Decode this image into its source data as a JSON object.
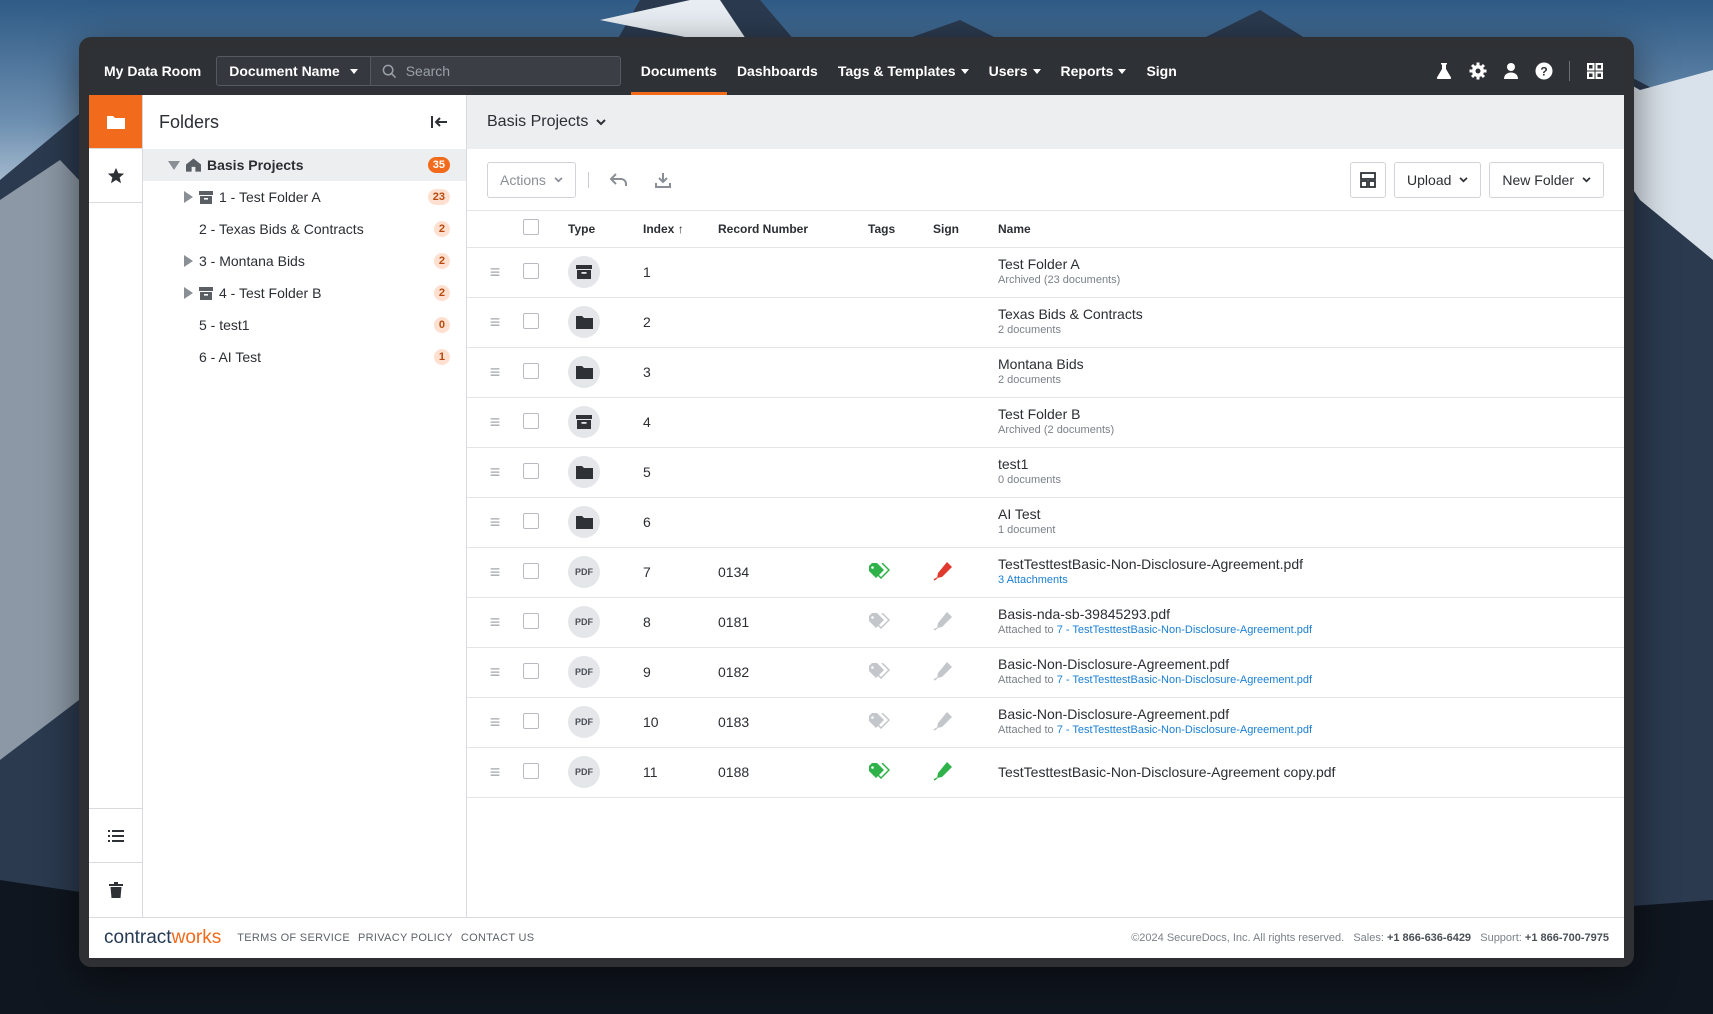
{
  "topnav": {
    "brand": "My Data Room",
    "doc_select": "Document Name",
    "search_placeholder": "Search",
    "links": [
      {
        "label": "Documents",
        "active": true,
        "dropdown": false
      },
      {
        "label": "Dashboards",
        "active": false,
        "dropdown": false
      },
      {
        "label": "Tags & Templates",
        "active": false,
        "dropdown": true
      },
      {
        "label": "Users",
        "active": false,
        "dropdown": true
      },
      {
        "label": "Reports",
        "active": false,
        "dropdown": true
      },
      {
        "label": "Sign",
        "active": false,
        "dropdown": false
      }
    ],
    "icons": [
      "flask-icon",
      "gear-icon",
      "user-icon",
      "help-icon",
      "apps-grid-icon"
    ]
  },
  "folders": {
    "title": "Folders",
    "root": {
      "label": "Basis Projects",
      "count": "35"
    },
    "items": [
      {
        "label": "1 - Test Folder A",
        "count": "23",
        "expandable": true,
        "archived": true
      },
      {
        "label": "2 - Texas Bids & Contracts",
        "count": "2",
        "expandable": false,
        "archived": false
      },
      {
        "label": "3 - Montana Bids",
        "count": "2",
        "expandable": true,
        "archived": false
      },
      {
        "label": "4 - Test Folder B",
        "count": "2",
        "expandable": true,
        "archived": true
      },
      {
        "label": "5 - test1",
        "count": "0",
        "expandable": false,
        "archived": false
      },
      {
        "label": "6 - AI Test",
        "count": "1",
        "expandable": false,
        "archived": false
      }
    ]
  },
  "content": {
    "breadcrumb": "Basis Projects",
    "toolbar": {
      "actions": "Actions",
      "upload": "Upload",
      "new_folder": "New Folder"
    },
    "columns": {
      "type": "Type",
      "index": "Index",
      "record": "Record Number",
      "tags": "Tags",
      "sign": "Sign",
      "name": "Name"
    },
    "rows": [
      {
        "type": "archive",
        "index": "1",
        "record": "",
        "tag": "",
        "sign": "",
        "title": "Test Folder A",
        "sub": "Archived (23 documents)",
        "sub_link": ""
      },
      {
        "type": "folder",
        "index": "2",
        "record": "",
        "tag": "",
        "sign": "",
        "title": "Texas Bids & Contracts",
        "sub": "2 documents",
        "sub_link": ""
      },
      {
        "type": "folder",
        "index": "3",
        "record": "",
        "tag": "",
        "sign": "",
        "title": "Montana Bids",
        "sub": "2 documents",
        "sub_link": ""
      },
      {
        "type": "archive",
        "index": "4",
        "record": "",
        "tag": "",
        "sign": "",
        "title": "Test Folder B",
        "sub": "Archived (2 documents)",
        "sub_link": ""
      },
      {
        "type": "folder",
        "index": "5",
        "record": "",
        "tag": "",
        "sign": "",
        "title": "test1",
        "sub": "0 documents",
        "sub_link": ""
      },
      {
        "type": "folder",
        "index": "6",
        "record": "",
        "tag": "",
        "sign": "",
        "title": "AI Test",
        "sub": "1 document",
        "sub_link": ""
      },
      {
        "type": "pdf",
        "index": "7",
        "record": "0134",
        "tag": "green",
        "sign": "red",
        "title": "TestTesttestBasic-Non-Disclosure-Agreement.pdf",
        "sub": "",
        "sub_link": "3 Attachments"
      },
      {
        "type": "pdf",
        "index": "8",
        "record": "0181",
        "tag": "gray",
        "sign": "gray",
        "title": "Basis-nda-sb-39845293.pdf",
        "sub": "Attached to ",
        "sub_link": "7 - TestTesttestBasic-Non-Disclosure-Agreement.pdf"
      },
      {
        "type": "pdf",
        "index": "9",
        "record": "0182",
        "tag": "gray",
        "sign": "gray",
        "title": "Basic-Non-Disclosure-Agreement.pdf",
        "sub": "Attached to ",
        "sub_link": "7 - TestTesttestBasic-Non-Disclosure-Agreement.pdf"
      },
      {
        "type": "pdf",
        "index": "10",
        "record": "0183",
        "tag": "gray",
        "sign": "gray",
        "title": "Basic-Non-Disclosure-Agreement.pdf",
        "sub": "Attached to ",
        "sub_link": "7 - TestTesttestBasic-Non-Disclosure-Agreement.pdf"
      },
      {
        "type": "pdf",
        "index": "11",
        "record": "0188",
        "tag": "green",
        "sign": "green",
        "title": "TestTesttestBasic-Non-Disclosure-Agreement copy.pdf",
        "sub": "",
        "sub_link": ""
      }
    ]
  },
  "footer": {
    "logo_a": "contract",
    "logo_b": "works",
    "links": [
      "Terms of Service",
      "Privacy Policy",
      "Contact Us"
    ],
    "copyright": "©2024 SecureDocs, Inc. All rights reserved.",
    "sales_label": "Sales:",
    "sales_phone": "+1 866-636-6429",
    "support_label": "Support:",
    "support_phone": "+1 866-700-7975"
  },
  "colors": {
    "accent": "#f26a1b",
    "nav_bg": "#2e3136",
    "link": "#1a7fd4",
    "tag_green": "#2fb24a",
    "sign_red": "#e03a2f",
    "icon_gray": "#c3c6ca"
  }
}
